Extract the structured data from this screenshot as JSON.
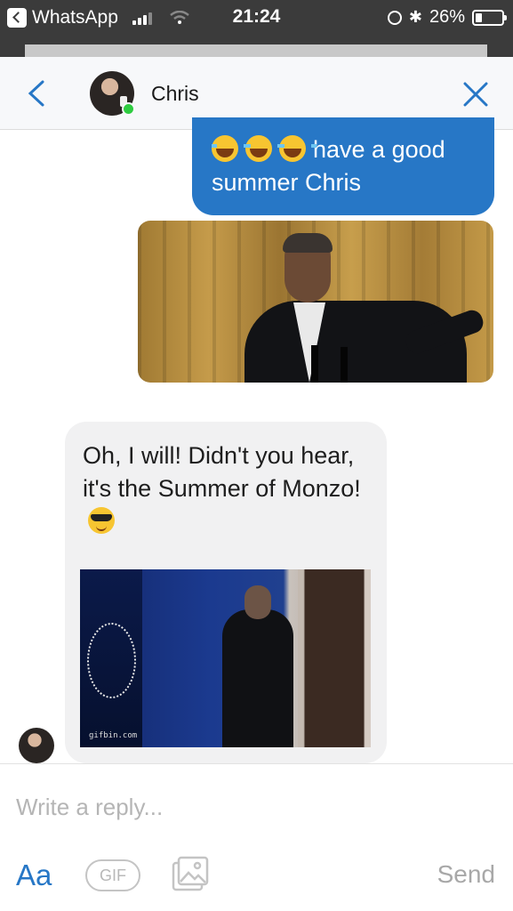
{
  "status_bar": {
    "back_app": "WhatsApp",
    "time": "21:24",
    "battery_percent": "26%",
    "battery_level": 0.26
  },
  "header": {
    "contact_name": "Chris",
    "online": true
  },
  "messages": {
    "outgoing_text": "have a good summer Chris",
    "outgoing_emojis": [
      "face-with-tears-of-joy",
      "face-with-tears-of-joy",
      "face-with-tears-of-joy"
    ],
    "incoming_text": "Oh, I will! Didn't you hear, it's the Summer of Monzo!",
    "incoming_emoji": "smiling-face-with-sunglasses",
    "incoming_gif_watermark": "gifbin.com"
  },
  "composer": {
    "placeholder": "Write a reply...",
    "format_label": "Aa",
    "gif_label": "GIF",
    "send_label": "Send"
  },
  "colors": {
    "accent": "#2777c6",
    "status_bar": "#3b3b3b",
    "incoming_bubble": "#f1f1f2",
    "online": "#2ecc40"
  }
}
